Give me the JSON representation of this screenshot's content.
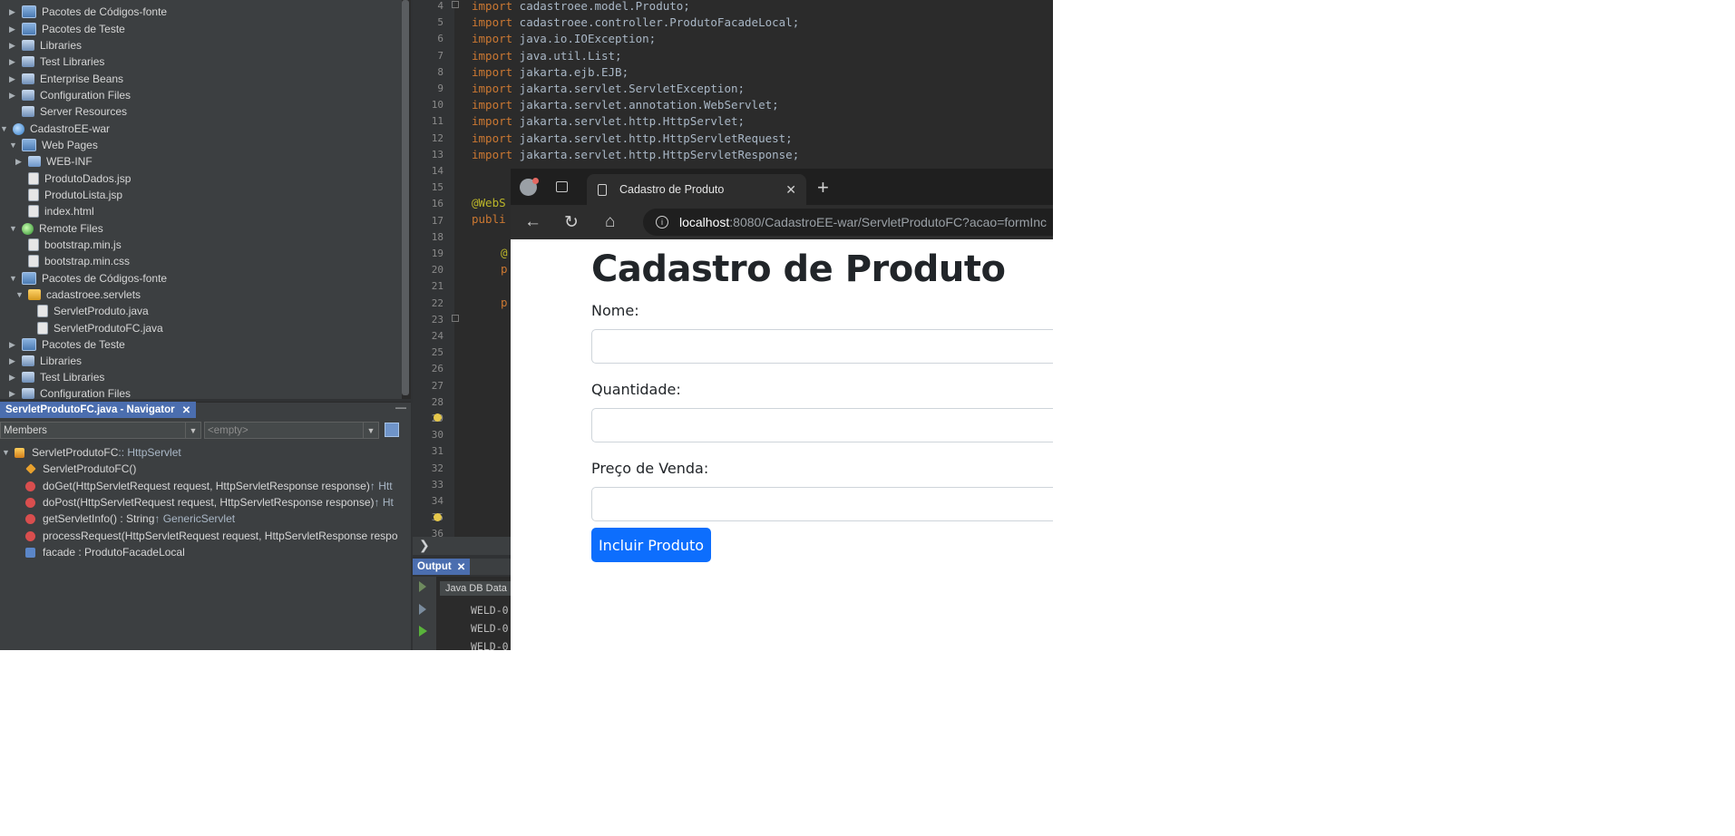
{
  "project_tree": [
    {
      "label": "Pacotes de Códigos-fonte",
      "toggle": "▶",
      "icon": "source-package-icon"
    },
    {
      "label": "Pacotes de Teste",
      "toggle": "▶",
      "icon": "test-package-icon"
    },
    {
      "label": "Libraries",
      "toggle": "▶",
      "icon": "libraries-icon"
    },
    {
      "label": "Test Libraries",
      "toggle": "▶",
      "icon": "test-libraries-icon"
    },
    {
      "label": "Enterprise Beans",
      "toggle": "▶",
      "icon": "enterprise-beans-icon"
    },
    {
      "label": "Configuration Files",
      "toggle": "▶",
      "icon": "configuration-files-icon"
    },
    {
      "label": "Server Resources",
      "toggle": "",
      "icon": "server-resources-icon"
    },
    {
      "label": "CadastroEE-war",
      "toggle": "▼",
      "icon": "web-project-icon"
    },
    {
      "label": "Web Pages",
      "toggle": "▼",
      "icon": "web-pages-icon"
    },
    {
      "label": "WEB-INF",
      "toggle": "▶",
      "icon": "folder-icon"
    },
    {
      "label": "ProdutoDados.jsp",
      "toggle": "",
      "icon": "jsp-file-icon"
    },
    {
      "label": "ProdutoLista.jsp",
      "toggle": "",
      "icon": "jsp-file-icon"
    },
    {
      "label": "index.html",
      "toggle": "",
      "icon": "html-file-icon"
    },
    {
      "label": "Remote Files",
      "toggle": "▼",
      "icon": "remote-files-icon"
    },
    {
      "label": "bootstrap.min.js",
      "toggle": "",
      "icon": "js-file-icon"
    },
    {
      "label": "bootstrap.min.css",
      "toggle": "",
      "icon": "css-file-icon"
    },
    {
      "label": "Pacotes de Códigos-fonte",
      "toggle": "▼",
      "icon": "source-package-icon"
    },
    {
      "label": "cadastroee.servlets",
      "toggle": "▼",
      "icon": "java-package-icon"
    },
    {
      "label": "ServletProduto.java",
      "toggle": "",
      "icon": "java-file-icon"
    },
    {
      "label": "ServletProdutoFC.java",
      "toggle": "",
      "icon": "java-file-icon"
    },
    {
      "label": "Pacotes de Teste",
      "toggle": "▶",
      "icon": "test-package-icon"
    },
    {
      "label": "Libraries",
      "toggle": "▶",
      "icon": "libraries-icon"
    },
    {
      "label": "Test Libraries",
      "toggle": "▶",
      "icon": "test-libraries-icon"
    },
    {
      "label": "Configuration Files",
      "toggle": "▶",
      "icon": "configuration-files-icon"
    }
  ],
  "navigator": {
    "tab_label": "ServletProdutoFC.java - Navigator",
    "close": "✕",
    "minimize": "—",
    "members_combo": "Members",
    "filter_combo": "<empty>",
    "combo_arrow": "▼",
    "members": [
      {
        "toggle": "▼",
        "icon": "class-icon",
        "name": "ServletProdutoFC",
        "suffix": " :: HttpServlet"
      },
      {
        "toggle": "",
        "icon": "constructor-icon",
        "name": "ServletProdutoFC()",
        "suffix": ""
      },
      {
        "toggle": "",
        "icon": "protected-method-icon",
        "name": "doGet(HttpServletRequest request, HttpServletResponse response)",
        "suffix": " ↑ Htt"
      },
      {
        "toggle": "",
        "icon": "protected-method-icon",
        "name": "doPost(HttpServletRequest request, HttpServletResponse response)",
        "suffix": " ↑ Ht"
      },
      {
        "toggle": "",
        "icon": "method-icon",
        "name": "getServletInfo() : String",
        "suffix": " ↑ GenericServlet"
      },
      {
        "toggle": "",
        "icon": "protected-method-icon",
        "name": "processRequest(HttpServletRequest request, HttpServletResponse respo",
        "suffix": ""
      },
      {
        "toggle": "",
        "icon": "field-icon",
        "name": "facade : ProdutoFacadeLocal",
        "suffix": ""
      }
    ]
  },
  "editor": {
    "line_numbers": [
      "4",
      "5",
      "6",
      "7",
      "8",
      "9",
      "10",
      "11",
      "12",
      "13",
      "14",
      "15",
      "16",
      "17",
      "18",
      "19",
      "20",
      "21",
      "22",
      "23",
      "24",
      "25",
      "26",
      "27",
      "28",
      "29",
      "30",
      "31",
      "32",
      "33",
      "34",
      "35",
      "36"
    ],
    "code_lines": [
      {
        "kw": "import",
        "rest": " cadastroee.model.Produto;"
      },
      {
        "kw": "import",
        "rest": " cadastroee.controller.ProdutoFacadeLocal;"
      },
      {
        "kw": "import",
        "rest": " java.io.IOException;"
      },
      {
        "kw": "import",
        "rest": " java.util.List;"
      },
      {
        "kw": "import",
        "rest": " jakarta.ejb.EJB;"
      },
      {
        "kw": "import",
        "rest": " jakarta.servlet.ServletException;"
      },
      {
        "kw": "import",
        "rest": " jakarta.servlet.annotation.WebServlet;"
      },
      {
        "kw": "import",
        "rest": " jakarta.servlet.http.HttpServlet;"
      },
      {
        "kw": "import",
        "rest": " jakarta.servlet.http.HttpServletRequest;"
      },
      {
        "kw": "import",
        "rest": " jakarta.servlet.http.HttpServletResponse;"
      }
    ],
    "partial_lines": [
      {
        "line": "16",
        "text": "@WebS"
      },
      {
        "line": "17",
        "text": "publi"
      },
      {
        "line": "19",
        "text": "@"
      },
      {
        "line": "20",
        "text": "p"
      },
      {
        "line": "22",
        "text": "p"
      }
    ],
    "bottom_chevron": "❯"
  },
  "output": {
    "tab_label": "Output",
    "close": "✕",
    "subtab": "Java DB Data",
    "lines": [
      "WELD-0",
      "WELD-0",
      "WELD-0"
    ]
  },
  "browser": {
    "tab_title": "Cadastro de Produto",
    "tab_close": "✕",
    "new_tab": "+",
    "back": "←",
    "reload": "↻",
    "home": "⌂",
    "info": "i",
    "url_host": "localhost",
    "url_rest": ":8080/CadastroEE-war/ServletProdutoFC?acao=formInc",
    "page": {
      "title": "Cadastro de Produto",
      "label_nome": "Nome:",
      "label_quantidade": "Quantidade:",
      "label_preco": "Preço de Venda:",
      "input_nome": "",
      "input_quantidade": "",
      "input_preco": "",
      "submit": "Incluir Produto",
      "submit_color": "#0d6efd"
    }
  }
}
